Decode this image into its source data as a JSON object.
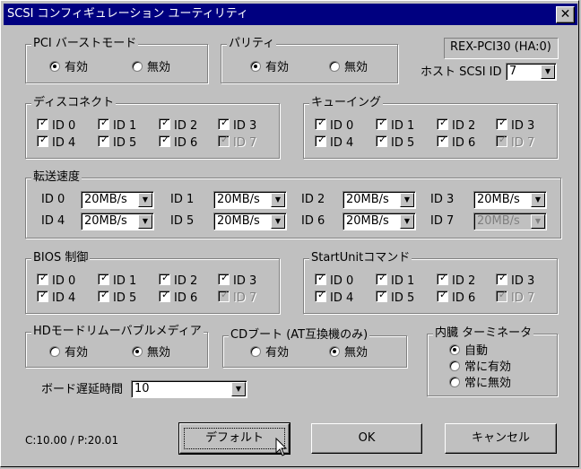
{
  "window": {
    "title": "SCSI コンフィギュレーション ユーティリティ",
    "close_glyph": "✕"
  },
  "pci_burst": {
    "legend": "PCI バーストモード",
    "options": [
      "有効",
      "無効"
    ],
    "selected": "有効"
  },
  "parity": {
    "legend": "パリティ",
    "options": [
      "有効",
      "無効"
    ],
    "selected": "有効"
  },
  "adapter": {
    "name": "REX-PCI30 (HA:0)",
    "host_id_label": "ホスト SCSI ID",
    "host_id_value": "7"
  },
  "disconnect": {
    "legend": "ディスコネクト",
    "items": [
      "ID 0",
      "ID 1",
      "ID 2",
      "ID 3",
      "ID 4",
      "ID 5",
      "ID 6",
      "ID 7"
    ]
  },
  "queuing": {
    "legend": "キューイング",
    "items": [
      "ID 0",
      "ID 1",
      "ID 2",
      "ID 3",
      "ID 4",
      "ID 5",
      "ID 6",
      "ID 7"
    ]
  },
  "transfer": {
    "legend": "転送速度",
    "rows": [
      {
        "label": "ID 0",
        "value": "20MB/s"
      },
      {
        "label": "ID 1",
        "value": "20MB/s"
      },
      {
        "label": "ID 2",
        "value": "20MB/s"
      },
      {
        "label": "ID 3",
        "value": "20MB/s"
      },
      {
        "label": "ID 4",
        "value": "20MB/s"
      },
      {
        "label": "ID 5",
        "value": "20MB/s"
      },
      {
        "label": "ID 6",
        "value": "20MB/s"
      },
      {
        "label": "ID 7",
        "value": "20MB/s"
      }
    ]
  },
  "bios": {
    "legend": "BIOS 制御",
    "items": [
      "ID 0",
      "ID 1",
      "ID 2",
      "ID 3",
      "ID 4",
      "ID 5",
      "ID 6",
      "ID 7"
    ]
  },
  "startunit": {
    "legend": "StartUnitコマンド",
    "items": [
      "ID 0",
      "ID 1",
      "ID 2",
      "ID 3",
      "ID 4",
      "ID 5",
      "ID 6",
      "ID 7"
    ]
  },
  "hd_removable": {
    "legend": "HDモードリムーバブルメディア",
    "options": [
      "有効",
      "無効"
    ],
    "selected": "無効"
  },
  "cd_boot": {
    "legend": "CDブート (AT互換機のみ)",
    "options": [
      "有効",
      "無効"
    ],
    "selected": "無効"
  },
  "terminator": {
    "legend": "内臓 ターミネータ",
    "options": [
      "自動",
      "常に有効",
      "常に無効"
    ],
    "selected": "自動"
  },
  "board_delay": {
    "label": "ボード遅延時間",
    "value": "10"
  },
  "version": "C:10.00 / P:20.01",
  "buttons": {
    "default": "デフォルト",
    "ok": "OK",
    "cancel": "キャンセル"
  }
}
